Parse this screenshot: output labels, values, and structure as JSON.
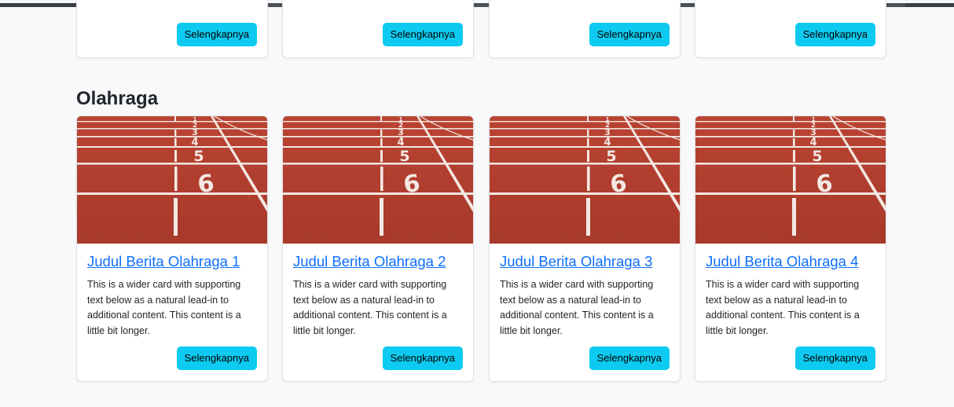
{
  "more_label": "Selengkapnya",
  "section": {
    "title": "Olahraga"
  },
  "cards": [
    {
      "title": "Judul Berita Olahraga 1",
      "text": "This is a wider card with supporting text below as a natural lead-in to additional content. This content is a little bit longer."
    },
    {
      "title": "Judul Berita Olahraga 2",
      "text": "This is a wider card with supporting text below as a natural lead-in to additional content. This content is a little bit longer."
    },
    {
      "title": "Judul Berita Olahraga 3",
      "text": "This is a wider card with supporting text below as a natural lead-in to additional content. This content is a little bit longer."
    },
    {
      "title": "Judul Berita Olahraga 4",
      "text": "This is a wider card with supporting text below as a natural lead-in to additional content. This content is a little bit longer."
    }
  ],
  "colors": {
    "button": "#0dcaf0",
    "link": "#0d6efd",
    "track": "#b23a2b"
  },
  "icons": {
    "card_image": "running-track-image"
  }
}
